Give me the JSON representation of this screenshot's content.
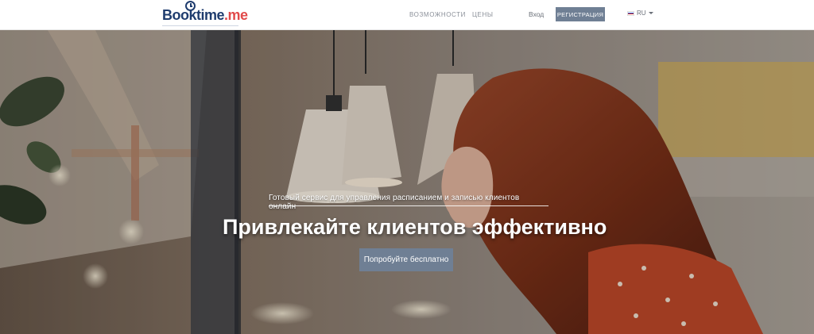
{
  "header": {
    "logo_text_main": "Booktime",
    "logo_text_suffix": ".me",
    "nav": {
      "features": "ВОЗМОЖНОСТИ",
      "prices": "ЦЕНЫ",
      "login": "Вход",
      "register": "РЕГИСТРАЦИЯ"
    },
    "language": "RU"
  },
  "hero": {
    "tagline": "Готовый сервис для управления расписанием и записью клиентов онлайн",
    "headline": "Привлекайте клиентов эффективно",
    "cta": "Попробуйте бесплатно"
  },
  "colors": {
    "logo_primary": "#1f3c6e",
    "logo_accent": "#e14a4a",
    "button": "#6f7f94"
  }
}
